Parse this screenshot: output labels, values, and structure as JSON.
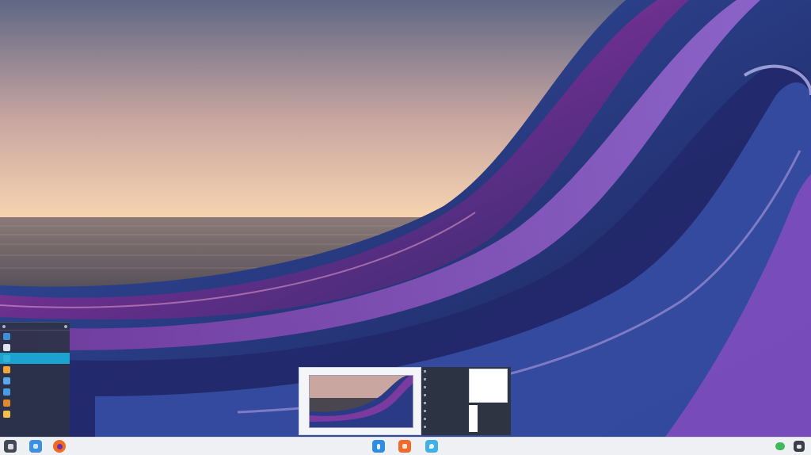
{
  "desktop": {
    "wallpaper_colors": {
      "sky_top": "#6f7590",
      "sky_glow": "#f2c9a6",
      "sea": "#4a4650",
      "wave_purple": "#6b2f8c",
      "wave_blue": "#233a86",
      "wave_highlight": "#b59ad6"
    }
  },
  "launcher": {
    "title": "",
    "items": [
      {
        "label": "",
        "meta": "",
        "color": "#3d8fd8"
      },
      {
        "label": "",
        "meta": "",
        "color": "#dfe5ef"
      },
      {
        "label": "",
        "meta": "",
        "color": "#2fb3d8",
        "active": true
      },
      {
        "label": "",
        "meta": "",
        "color": "#f0a43a"
      },
      {
        "label": "",
        "meta": "",
        "color": "#5aa8e8"
      },
      {
        "label": "",
        "meta": "",
        "color": "#4a9be0"
      },
      {
        "label": "",
        "meta": "",
        "color": "#e08a2c"
      },
      {
        "label": "",
        "meta": "",
        "color": "#f2c14a"
      }
    ]
  },
  "preview": {
    "caption": "",
    "panel_rows": [
      "",
      "",
      "",
      "",
      "",
      "",
      "",
      ""
    ],
    "card_rows": [
      "",
      "",
      "",
      "",
      ""
    ],
    "card_list": [
      "",
      "",
      "",
      ""
    ]
  },
  "taskbar": {
    "colors": {
      "menu": "#444a55",
      "files": "#3d8fe0",
      "firefox": "#f26b1d",
      "store": "#2f8ee0",
      "app_orange": "#f06a2c",
      "maps": "#3fb1e6",
      "tray_green": "#3dbb5a"
    },
    "tray": {
      "left_text": "",
      "right_text": ""
    }
  }
}
